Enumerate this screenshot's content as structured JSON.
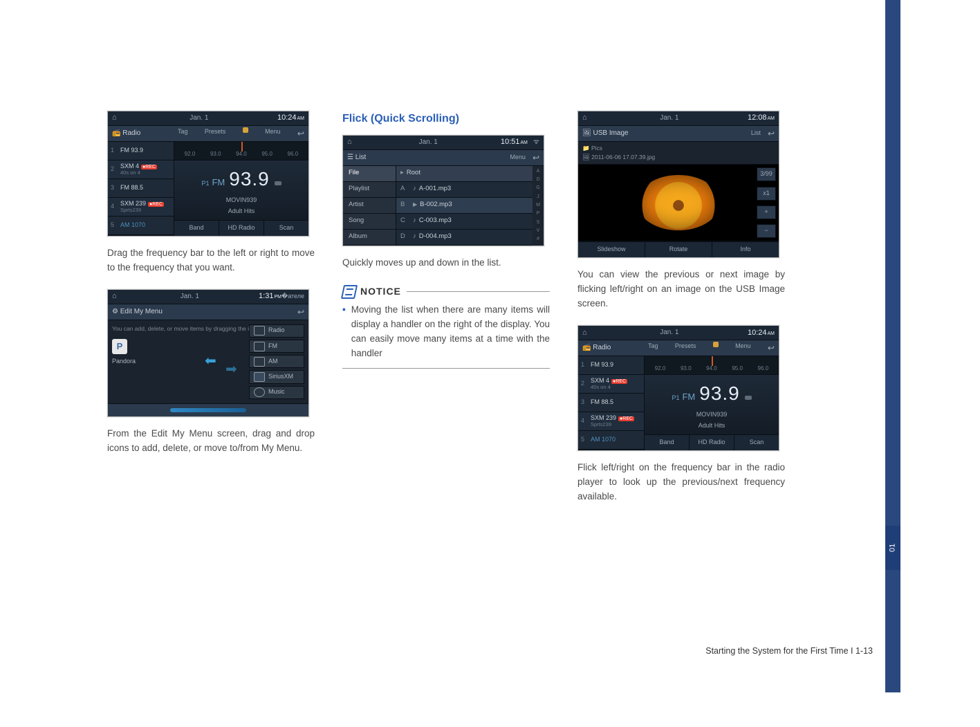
{
  "col1": {
    "radio_shot": {
      "date": "Jan.  1",
      "time": "10:24",
      "ampm": "AM",
      "title": "Radio",
      "tabs": [
        "Tag",
        "Presets",
        "",
        "Menu"
      ],
      "freq_ticks": [
        "92.0",
        "93.0",
        "94.0",
        "95.0",
        "96.0"
      ],
      "presets": [
        {
          "n": "1",
          "main": "FM 93.9",
          "sub": ""
        },
        {
          "n": "2",
          "main": "SXM 4",
          "sub": "40s on 4",
          "rec": true
        },
        {
          "n": "3",
          "main": "FM 88.5",
          "sub": ""
        },
        {
          "n": "4",
          "main": "SXM 239",
          "sub": "Sprts239",
          "rec": true
        },
        {
          "n": "5",
          "main": "AM 1070",
          "sub": ""
        }
      ],
      "now_preset": "P1",
      "now_band": "FM",
      "now_freq": "93.9",
      "station": "MOVIN939",
      "genre": "Adult Hits",
      "footer": [
        "Band",
        "HD Radio",
        "Scan"
      ]
    },
    "para1": "Drag the frequency bar to the left or right to move to the frequency that you want.",
    "editmenu_shot": {
      "date": "Jan.  1",
      "time": "1:31",
      "ampm": "PM",
      "title": "Edit My Menu",
      "hint": "You can add, delete, or move items by dragging the icons.",
      "pandora": "Pandora",
      "right_items": [
        "Radio",
        "FM",
        "AM",
        "SiriusXM",
        "Music"
      ]
    },
    "para2_a": "From the ",
    "para2_b": "Edit My Menu",
    "para2_c": " screen, drag and drop icons to add, delete, or move to/from ",
    "para2_d": "My Menu",
    "para2_e": "."
  },
  "col2": {
    "heading": "Flick (Quick Scrolling)",
    "list_shot": {
      "date": "Jan.  1",
      "time": "10:51",
      "ampm": "AM",
      "title": "List",
      "menu": "Menu",
      "left_items": [
        "File",
        "Playlist",
        "Artist",
        "Song",
        "Album"
      ],
      "root_label": "Root",
      "rows": [
        {
          "l": "A",
          "t": "A-001.mp3",
          "icon": "note"
        },
        {
          "l": "B",
          "t": "B-002.mp3",
          "icon": "play"
        },
        {
          "l": "C",
          "t": "C-003.mp3",
          "icon": "note"
        },
        {
          "l": "D",
          "t": "D-004.mp3",
          "icon": "note"
        }
      ],
      "index_letters": [
        "A",
        "D",
        "G",
        "J",
        "M",
        "P",
        "S",
        "V",
        "#"
      ]
    },
    "para3": "Quickly moves up and down in the list.",
    "notice_label": "NOTICE",
    "notice_bullet": "Moving the list when there are many items will display a handler on the right of the display. You can easily move many items at a time with the handler"
  },
  "col3": {
    "usb_shot": {
      "date": "Jan.  1",
      "time": "12:08",
      "ampm": "AM",
      "title": "USB Image",
      "list_btn": "List",
      "crumb1": "Pics",
      "crumb2": "2011-06-06 17.07.39.jpg",
      "counter": "3/99",
      "zoom": "x1",
      "ctrl_plus": "+",
      "ctrl_minus": "−",
      "footer": [
        "Slideshow",
        "Rotate",
        "Info"
      ]
    },
    "para4": "You can view the previous or next image by flicking left/right on an image on the USB Image screen.",
    "para5": "Flick left/right on the frequency bar in the radio player to look up the previous/next frequency available."
  },
  "footer": "Starting the System for the First Time I 1-13",
  "side_tab": "01"
}
